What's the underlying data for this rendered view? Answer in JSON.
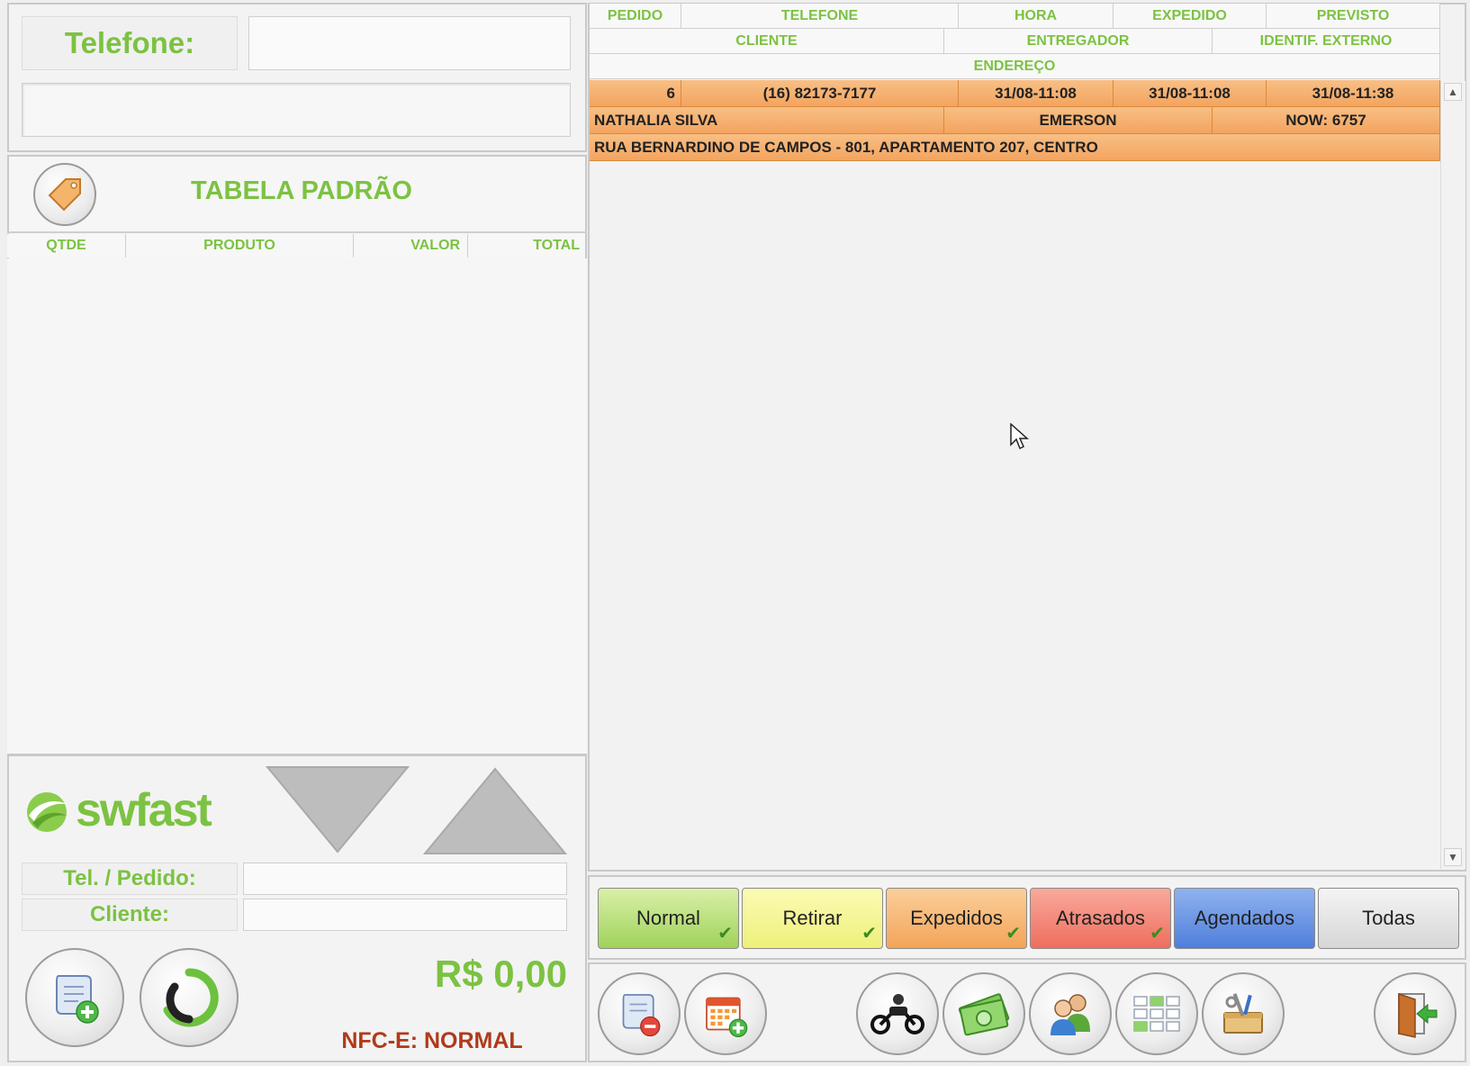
{
  "top_left": {
    "phone_label": "Telefone:",
    "phone_value": ""
  },
  "price_table": {
    "title": "TABELA PADRÃO",
    "columns": [
      "QTDE",
      "PRODUTO",
      "VALOR",
      "TOTAL"
    ]
  },
  "brand": {
    "logo_text": "swfast"
  },
  "order_lookup": {
    "tel_pedido_label": "Tel. / Pedido:",
    "cliente_label": "Cliente:"
  },
  "totals": {
    "value": "R$ 0,00",
    "nfce_status": "NFC-E: NORMAL"
  },
  "orders_grid": {
    "header_row1": [
      "PEDIDO",
      "TELEFONE",
      "HORA",
      "EXPEDIDO",
      "PREVISTO"
    ],
    "header_row2": [
      "CLIENTE",
      "ENTREGADOR",
      "IDENTIF. EXTERNO"
    ],
    "header_row3": [
      "ENDEREÇO"
    ],
    "orders": [
      {
        "pedido": "6",
        "telefone": "(16) 82173-7177",
        "hora": "31/08-11:08",
        "expedido": "31/08-11:08",
        "previsto": "31/08-11:38",
        "cliente": "NATHALIA SILVA",
        "entregador": "EMERSON",
        "identif_externo": "NOW: 6757",
        "endereco": "RUA BERNARDINO DE CAMPOS - 801, APARTAMENTO 207, CENTRO"
      }
    ]
  },
  "filters": [
    {
      "label": "Normal",
      "color_top": "#d9f0a8",
      "color_bottom": "#9fd25a",
      "checked": true
    },
    {
      "label": "Retirar",
      "color_top": "#fbfbb4",
      "color_bottom": "#eef07a",
      "checked": true
    },
    {
      "label": "Expedidos",
      "color_top": "#fbcf9b",
      "color_bottom": "#f3a458",
      "checked": true
    },
    {
      "label": "Atrasados",
      "color_top": "#f9a99b",
      "color_bottom": "#ee6e5e",
      "checked": true
    },
    {
      "label": "Agendados",
      "color_top": "#8fb2ef",
      "color_bottom": "#4f7fdc",
      "checked": false
    },
    {
      "label": "Todas",
      "color_top": "#f4f4f4",
      "color_bottom": "#d6d6d6",
      "checked": false
    }
  ],
  "colors": {
    "accent_green": "#7cc242",
    "order_row": "#f3a45f",
    "nfce_red": "#b03a1a"
  },
  "icons": {
    "tag": "price-tag-icon",
    "new_order": "scroll-add-icon",
    "refresh": "swirl-refresh-icon",
    "cancel_order": "scroll-remove-icon",
    "schedule": "calendar-add-icon",
    "delivery": "motorcycle-icon",
    "payment": "money-icon",
    "clients": "users-icon",
    "tables": "table-grid-icon",
    "tools": "toolbox-icon",
    "exit": "exit-door-icon"
  }
}
